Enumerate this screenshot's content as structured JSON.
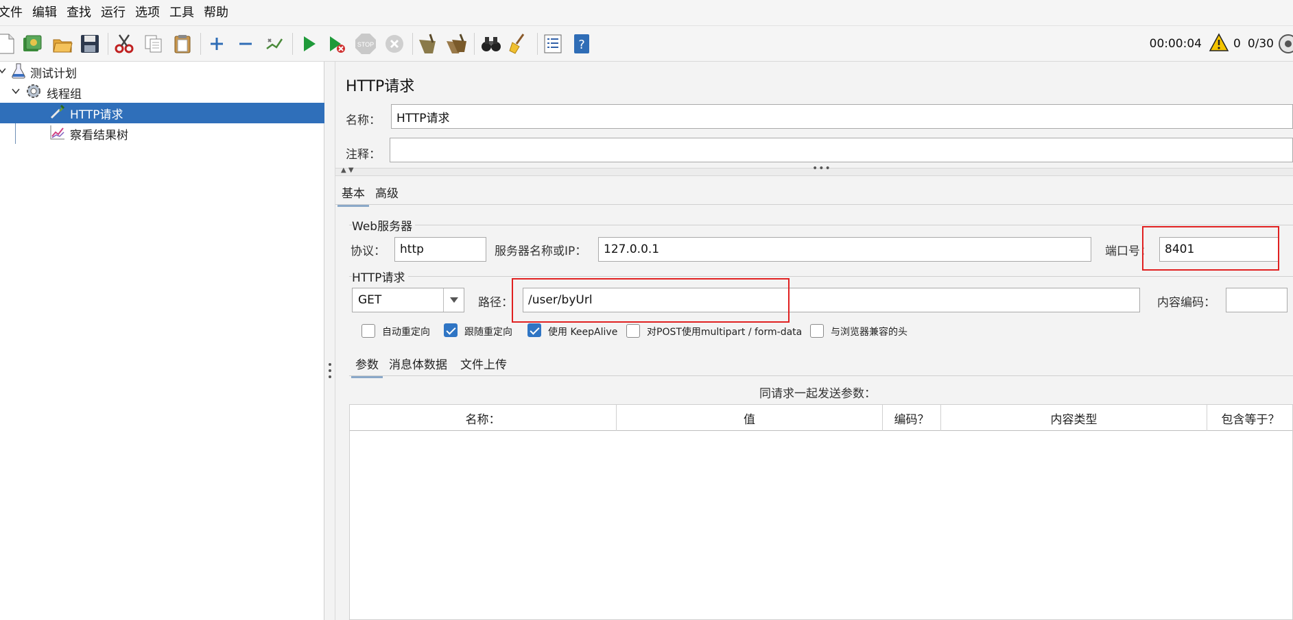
{
  "menu": [
    "文件",
    "编辑",
    "查找",
    "运行",
    "选项",
    "工具",
    "帮助"
  ],
  "status": {
    "elapsed": "00:00:04",
    "warnings": "0",
    "threads": "0/30"
  },
  "tree": {
    "root": "测试计划",
    "thread_group": "线程组",
    "http_request": "HTTP请求",
    "result_tree": "察看结果树"
  },
  "panel": {
    "title": "HTTP请求",
    "name_label": "名称：",
    "name_value": "HTTP请求",
    "comment_label": "注释：",
    "comment_value": "",
    "tabs": [
      "基本",
      "高级"
    ],
    "web_server_section": "Web服务器",
    "protocol_label": "协议：",
    "protocol_value": "http",
    "server_label": "服务器名称或IP：",
    "server_value": "127.0.0.1",
    "port_label": "端口号：",
    "port_value": "8401",
    "http_section": "HTTP请求",
    "method_value": "GET",
    "path_label": "路径：",
    "path_value": "/user/byUrl",
    "encoding_label": "内容编码：",
    "encoding_value": "",
    "checkboxes": [
      {
        "label": "自动重定向",
        "checked": false
      },
      {
        "label": "跟随重定向",
        "checked": true
      },
      {
        "label": "使用 KeepAlive",
        "checked": true
      },
      {
        "label": "对POST使用multipart / form-data",
        "checked": false
      },
      {
        "label": "与浏览器兼容的头",
        "checked": false
      }
    ],
    "subtabs": [
      "参数",
      "消息体数据",
      "文件上传"
    ],
    "params_caption": "同请求一起发送参数：",
    "table_headers": [
      "名称：",
      "值",
      "编码？",
      "内容类型",
      "包含等于？"
    ]
  }
}
